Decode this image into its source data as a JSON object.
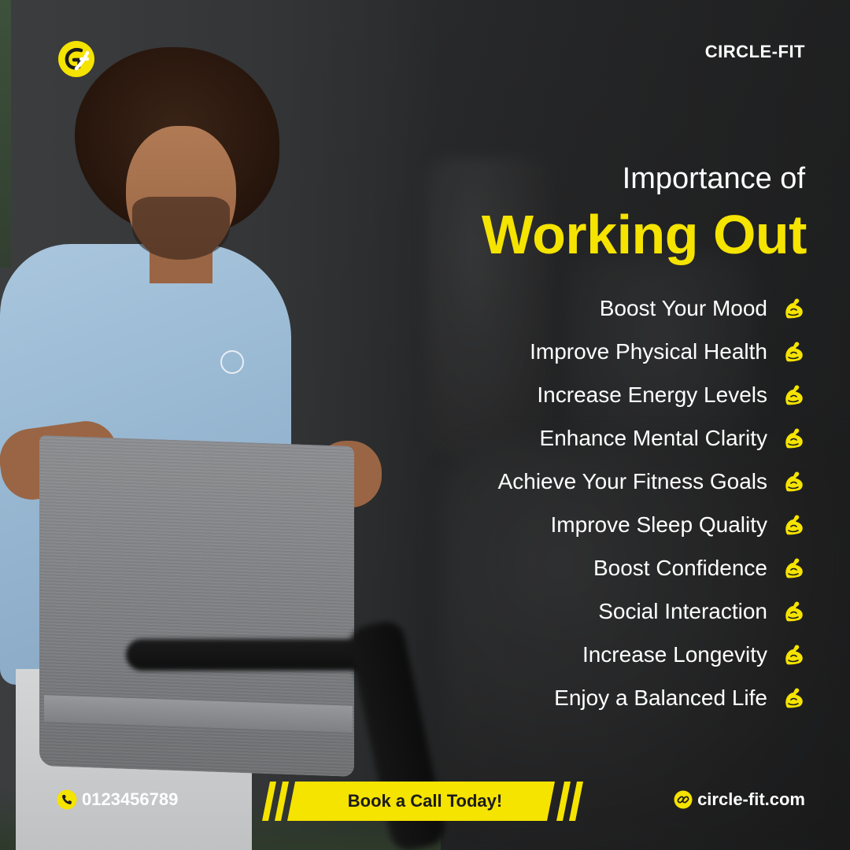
{
  "brand": {
    "name": "CIRCLE-FIT",
    "logo_text": "GF",
    "accent_color": "#f5e300"
  },
  "headline": {
    "line1": "Importance of",
    "line2": "Working Out"
  },
  "benefits": [
    {
      "label": "Boost Your Mood",
      "icon": "flexed-bicep-icon"
    },
    {
      "label": "Improve Physical Health",
      "icon": "flexed-bicep-icon"
    },
    {
      "label": "Increase Energy Levels",
      "icon": "flexed-bicep-icon"
    },
    {
      "label": "Enhance Mental Clarity",
      "icon": "flexed-bicep-icon"
    },
    {
      "label": "Achieve Your Fitness Goals",
      "icon": "flexed-bicep-icon"
    },
    {
      "label": "Improve Sleep Quality",
      "icon": "flexed-bicep-icon"
    },
    {
      "label": "Boost Confidence",
      "icon": "flexed-bicep-icon"
    },
    {
      "label": "Social Interaction",
      "icon": "flexed-bicep-icon"
    },
    {
      "label": "Increase Longevity",
      "icon": "flexed-bicep-icon"
    },
    {
      "label": "Enjoy a Balanced Life",
      "icon": "flexed-bicep-icon"
    }
  ],
  "footer": {
    "phone": "0123456789",
    "phone_icon": "phone-icon",
    "cta_label": "Book a Call Today!",
    "website": "circle-fit.com",
    "website_icon": "link-icon"
  },
  "colors": {
    "accent": "#f5e300",
    "text": "#ffffff",
    "background": "#2a2b2c"
  }
}
